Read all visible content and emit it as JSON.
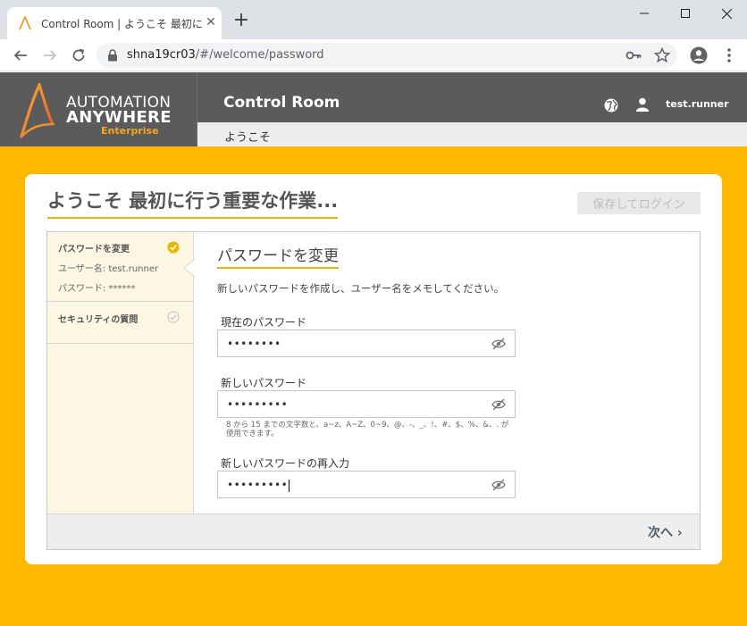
{
  "browser": {
    "tab_title": "Control Room | ようこそ 最初に行う重要",
    "url_host": "shna19cr03",
    "url_path": "/#/welcome/password"
  },
  "header": {
    "logo_line1": "AUTOMATION",
    "logo_line2": "ANYWHERE",
    "logo_line3": "Enterprise",
    "title": "Control Room",
    "username": "test.runner",
    "subnav_label": "ようこそ"
  },
  "page": {
    "title": "ようこそ 最初に行う重要な作業...",
    "save_login_label": "保存してログイン"
  },
  "steps": [
    {
      "title": "パスワードを変更",
      "lines": [
        "ユーザー名: test.runner",
        "パスワード: ******"
      ],
      "done": true
    },
    {
      "title": "セキュリティの質問",
      "done": false
    }
  ],
  "form": {
    "section_title": "パスワードを変更",
    "description": "新しいパスワードを作成し、ユーザー名をメモしてください。",
    "current_password": {
      "label": "現在のパスワード",
      "value": "••••••••"
    },
    "new_password": {
      "label": "新しいパスワード",
      "value": "•••••••••",
      "hint": "8 から 15 までの文字数と、a~z、A~Z、0~9、@、-、_、!、#、$、%、&、. が使用できます。"
    },
    "confirm_password": {
      "label": "新しいパスワードの再入力",
      "value": "•••••••••"
    }
  },
  "footer": {
    "next_label": "次へ"
  },
  "colors": {
    "accent": "#ffb800",
    "header_bg": "#5b5b5b",
    "brand_orange": "#f5a623"
  }
}
